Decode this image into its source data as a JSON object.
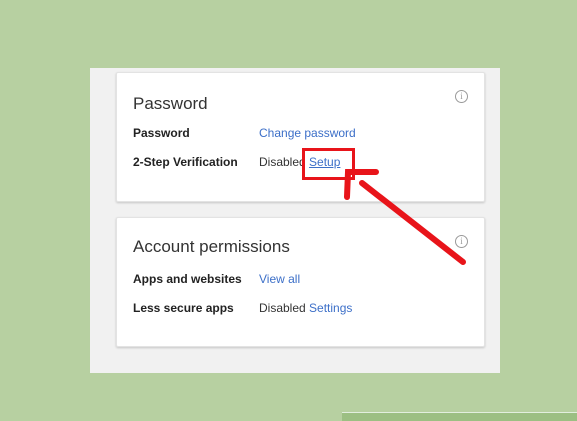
{
  "password_card": {
    "title": "Password",
    "info_icon": "info-icon",
    "rows": [
      {
        "label": "Password",
        "status": "",
        "link": "Change password"
      },
      {
        "label": "2-Step Verification",
        "status": "Disabled",
        "link": "Setup"
      }
    ]
  },
  "permissions_card": {
    "title": "Account permissions",
    "info_icon": "info-icon",
    "rows": [
      {
        "label": "Apps and websites",
        "status": "",
        "link": "View all"
      },
      {
        "label": "Less secure apps",
        "status": "Disabled",
        "link": "Settings"
      }
    ]
  },
  "annotation": {
    "highlight_color": "#e8141a",
    "arrow_icon": "red-arrow-icon"
  },
  "colors": {
    "background": "#b7d0a1",
    "panel": "#f1f1f1",
    "link": "#3c6fc8"
  }
}
